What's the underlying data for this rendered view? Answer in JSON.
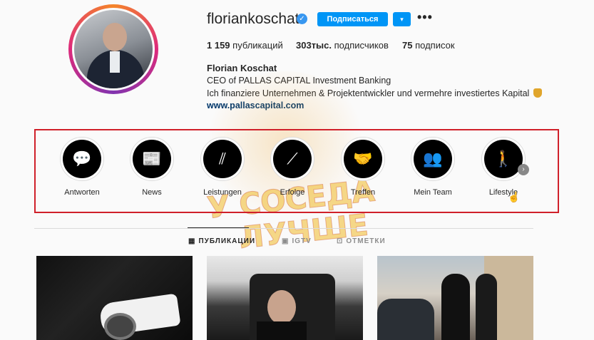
{
  "profile": {
    "username": "floriankoschat",
    "verified_icon": "verified-badge",
    "follow_label": "Подписаться",
    "dropdown_icon": "▾",
    "more_icon": "•••",
    "stats": {
      "posts_count": "1 159",
      "posts_label": " публикаций",
      "followers_count": "303тыс.",
      "followers_label": " подписчиков",
      "following_count": "75",
      "following_label": " подписок"
    },
    "full_name": "Florian Koschat",
    "bio_line1": "CEO of PALLAS CAPITAL Investment Banking",
    "bio_line2": "Ich finanziere Unternehmen & Projektentwickler und vermehre investiertes Kapital",
    "website": "www.pallascapital.com"
  },
  "highlights": [
    {
      "label": "Antworten",
      "icon": "speech-bubble-icon",
      "glyph": "💬"
    },
    {
      "label": "News",
      "icon": "newspaper-icon",
      "glyph": "📰"
    },
    {
      "label": "Leistungen",
      "icon": "logo-icon",
      "glyph": "⫽"
    },
    {
      "label": "Erfolge",
      "icon": "stairs-icon",
      "glyph": "⟋"
    },
    {
      "label": "Treffen",
      "icon": "handshake-icon",
      "glyph": "🤝"
    },
    {
      "label": "Mein Team",
      "icon": "team-icon",
      "glyph": "👥"
    },
    {
      "label": "Lifestyle",
      "icon": "person-icon",
      "glyph": "🚶"
    }
  ],
  "tabs": [
    {
      "label": "ПУБЛИКАЦИИ",
      "icon": "grid-icon",
      "glyph": "▦",
      "active": true
    },
    {
      "label": "IGTV",
      "icon": "tv-icon",
      "glyph": "▣",
      "active": false
    },
    {
      "label": "ОТМЕТКИ",
      "icon": "tag-icon",
      "glyph": "⊡",
      "active": false
    }
  ],
  "watermark": {
    "line1": "У СОСЕДА",
    "line2": "ЛУЧШЕ"
  },
  "colors": {
    "accent": "#0095f6",
    "highlight_box": "#d0202a",
    "link": "#00376b"
  }
}
